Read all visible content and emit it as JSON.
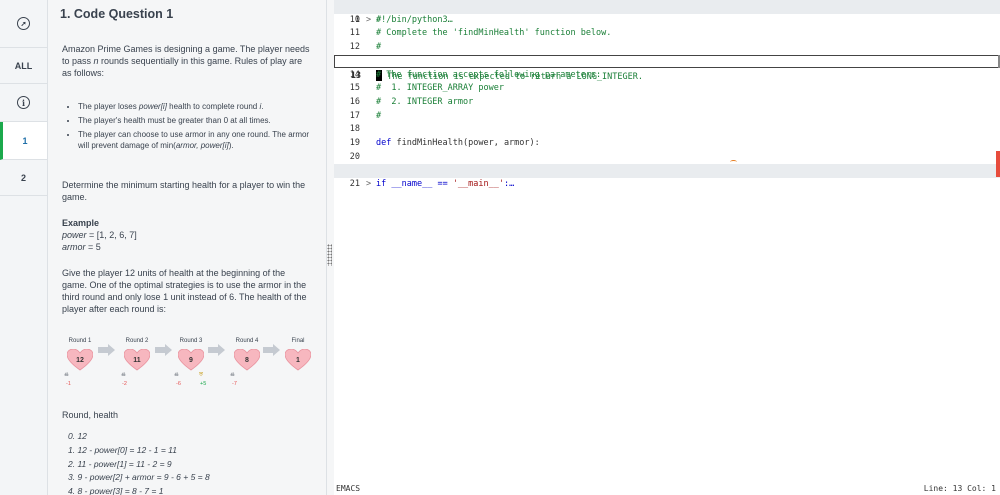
{
  "nav": {
    "items": [
      {
        "label": "",
        "icon": "compass-icon"
      },
      {
        "label": "ALL"
      },
      {
        "label": "",
        "icon": "info-icon"
      },
      {
        "label": "1"
      },
      {
        "label": "2"
      }
    ]
  },
  "problem": {
    "title": "1. Code Question 1",
    "intro": [
      "Amazon Prime Games is designing a game. The player needs to pass ",
      "n",
      " rounds sequentially in this game. Rules of play are as follows:"
    ],
    "rules": [
      [
        "The player loses ",
        "power[i]",
        " health to complete round ",
        "i",
        "."
      ],
      [
        "The player's health must be greater than 0 at all times.",
        "",
        "",
        "",
        ""
      ],
      [
        "The player can choose to use armor in any one round. The armor will prevent damage of min(",
        "armor, power[i]",
        ").",
        "",
        ""
      ]
    ],
    "task": "Determine the minimum starting health for a player to win the game.",
    "example_heading": "Example",
    "example_power_var": "power",
    "example_power_val": " = [1, 2, 6, 7]",
    "example_armor_var": "armor",
    "example_armor_val": " = 5",
    "explanation": "Give the player 12 units of health at the beginning of the game. One of the optimal strategies is to use the armor in the third round and only lose 1 unit instead of 6. The health of the player after each round is:",
    "rounds": [
      {
        "label": "Round 1",
        "health": "12",
        "loss": "-1"
      },
      {
        "label": "Round 2",
        "health": "11",
        "loss": "-2"
      },
      {
        "label": "Round 3",
        "health": "9",
        "loss": "-6",
        "gain": "+5"
      },
      {
        "label": "Round 4",
        "health": "8",
        "loss": "-7"
      },
      {
        "label": "Final",
        "health": "1"
      }
    ],
    "table_heading": "Round, health",
    "steps": [
      "0.  12",
      "1.  12 - power[0] = 12 - 1 = 11",
      "2.  11 - power[1] = 11 - 2 = 9",
      "3.  9 - power[2] + armor = 9 - 6 + 5 = 8",
      "4.  8 - power[3] = 8 - 7 = 1"
    ]
  },
  "editor": {
    "lines": [
      {
        "num": "1",
        "fold": ">",
        "text": "#!/bin/python3…",
        "kind": "cm",
        "hl": true
      },
      {
        "num": "10",
        "text": "#",
        "kind": "cm"
      },
      {
        "num": "11",
        "text": "# Complete the 'findMinHealth' function below.",
        "kind": "cm"
      },
      {
        "num": "12",
        "text": "#",
        "kind": "cm"
      },
      {
        "num": "13",
        "text": " The function is expected to return a LONG_INTEGER.",
        "kind": "cm",
        "cursor": true
      },
      {
        "num": "14",
        "text": "# The function accepts following parameters:",
        "kind": "cm"
      },
      {
        "num": "15",
        "text": "#  1. INTEGER_ARRAY power",
        "kind": "cm"
      },
      {
        "num": "16",
        "text": "#  2. INTEGER armor",
        "kind": "cm"
      },
      {
        "num": "17",
        "text": "#",
        "kind": "cm"
      },
      {
        "num": "18",
        "text": "",
        "kind": "plain"
      },
      {
        "num": "19",
        "text": "def findMinHealth(power, armor):",
        "kind": "def"
      },
      {
        "num": "20",
        "text": "",
        "kind": "plain"
      },
      {
        "num": "21",
        "fold": ">",
        "text": "if __name__ == '__main__':…",
        "kind": "main",
        "hl": true
      }
    ],
    "mode": "EMACS",
    "position": "Line: 13 Col: 1"
  },
  "colors": {
    "accent": "#1ba94c",
    "comment": "#1a7f37",
    "keyword": "#0000cc",
    "heart": "#f7b7bf"
  }
}
